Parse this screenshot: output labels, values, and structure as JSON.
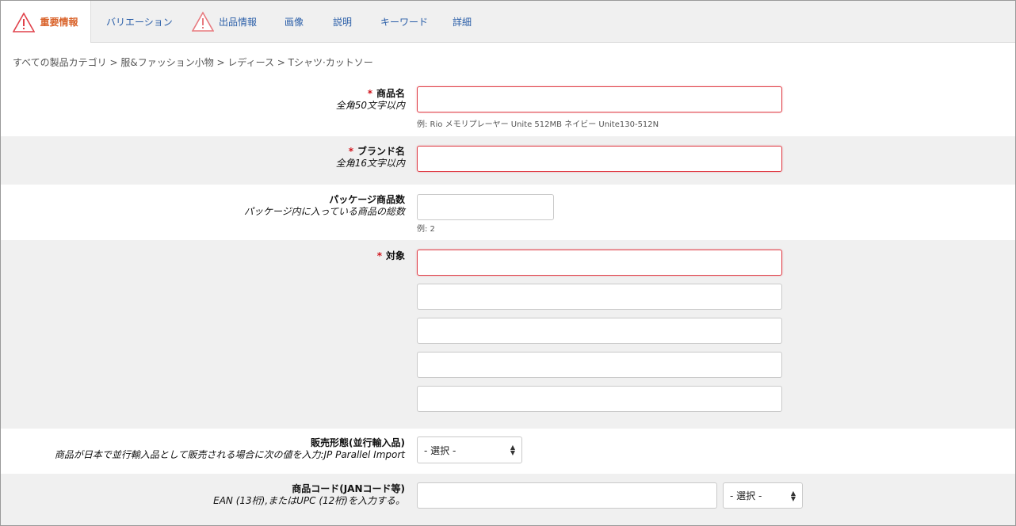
{
  "tabs": [
    {
      "label": "重要情報",
      "warning": true,
      "active": true
    },
    {
      "label": "バリエーション"
    },
    {
      "label": "出品情報",
      "warning": true
    },
    {
      "label": "画像"
    },
    {
      "label": "説明"
    },
    {
      "label": "キーワード"
    },
    {
      "label": "詳細"
    }
  ],
  "breadcrumb": "すべての製品カテゴリ > 服&ファッション小物 > レディース > Tシャツ·カットソー",
  "fields": {
    "product_name": {
      "required": "*",
      "label": "商品名",
      "sub": "全角50文字以内",
      "value": "",
      "example": "例:  Rio メモリプレーヤー Unite 512MB ネイビー Unite130-512N"
    },
    "brand_name": {
      "required": "*",
      "label": "ブランド名",
      "sub": "全角16文字以内",
      "value": ""
    },
    "package_qty": {
      "label": "パッケージ商品数",
      "sub": "パッケージ内に入っている商品の総数",
      "value": "",
      "example": "例:  2"
    },
    "target": {
      "required": "*",
      "label": "対象",
      "values": [
        "",
        "",
        "",
        "",
        ""
      ]
    },
    "sales_form": {
      "label": "販売形態(並行輸入品)",
      "sub": "商品が日本で並行輸入品として販売される場合に次の値を入力:JP Parallel Import",
      "selected": "- 選択 -"
    },
    "product_code": {
      "label": "商品コード(JANコード等)",
      "sub": "EAN (13桁),またはUPC (12桁)を入力する。",
      "value": "",
      "selected": "- 選択 -"
    }
  },
  "colors": {
    "required": "#d0141c",
    "link": "#2a5ea8",
    "active_tab": "#d9622a",
    "error_border": "#e0414a"
  }
}
